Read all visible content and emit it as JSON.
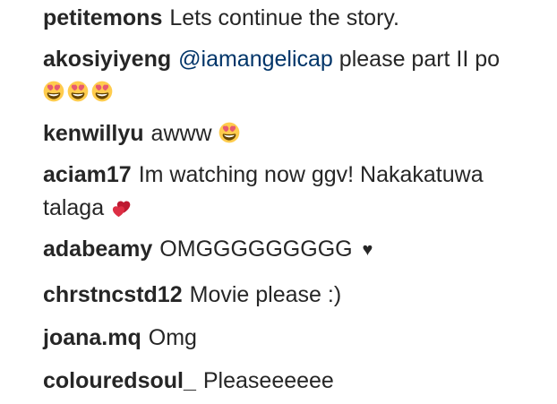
{
  "comments": [
    {
      "user": "petitemons",
      "text": "Lets continue the story."
    },
    {
      "user": "akosiyiyeng",
      "mention": "@iamangelicap",
      "text": "please part II po"
    },
    {
      "user": "kenwillyu",
      "text": "awww"
    },
    {
      "user": "aciam17",
      "text": "Im watching now ggv! Nakakatuwa",
      "text2": "talaga"
    },
    {
      "user": "adabeamy",
      "text": "OMGGGGGGGGG",
      "glyph": "♥"
    },
    {
      "user": "chrstncstd12",
      "text": "Movie please :)"
    },
    {
      "user": "joana.mq",
      "text": "Omg"
    },
    {
      "user": "colouredsoul_",
      "text": "Pleaseeeeee"
    }
  ],
  "icons": {
    "heart_eyes": "smiling-face-with-heart-eyes-icon",
    "two_hearts": "two-hearts-icon",
    "black_heart": "black-heart-icon"
  },
  "colors": {
    "username": "#262626",
    "text": "#262626",
    "mention": "#003569",
    "emoji_face": "#FFCC4D",
    "emoji_heart": "#DD2E44",
    "two_hearts": "#BE1931"
  }
}
